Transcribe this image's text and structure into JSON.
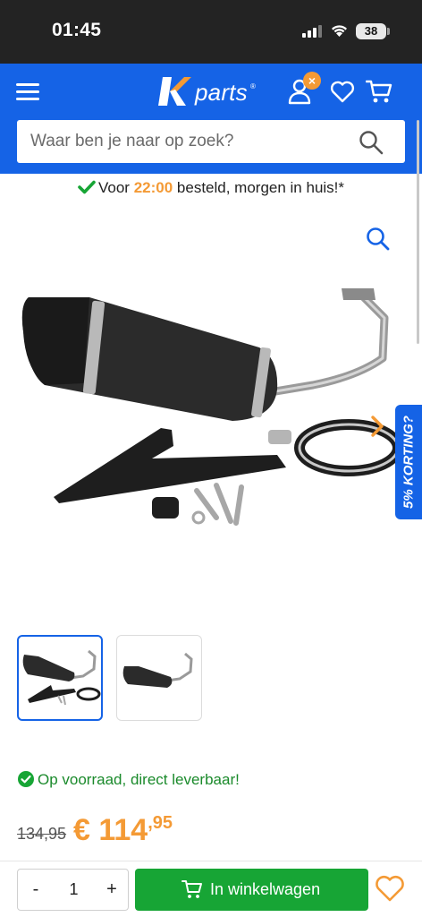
{
  "status_bar": {
    "time": "01:45",
    "battery": "38"
  },
  "header": {
    "logo_text": "parts",
    "logo_mark": "K",
    "user_badge": "×",
    "icons": [
      "menu-icon",
      "user-icon",
      "heart-icon",
      "cart-icon"
    ],
    "search": {
      "placeholder": "Waar ben je naar op zoek?"
    }
  },
  "delivery": {
    "before": "Voor",
    "time": "22:00",
    "after": "besteld, morgen in huis!*"
  },
  "product": {
    "gallery_icons": [
      "zoom-icon",
      "chevron-right-icon"
    ],
    "discount_tab": "5% KORTING?",
    "stock": "Op voorraad, direct leverbaar!",
    "old_price": "134,95",
    "price_main": "€ 114",
    "price_cents": ",95"
  },
  "cart_bar": {
    "minus": "-",
    "quantity": "1",
    "plus": "+",
    "add_label": "In winkelwagen"
  },
  "colors": {
    "brand_blue": "#1563e6",
    "accent_orange": "#f49a35",
    "success_green": "#17a535"
  }
}
